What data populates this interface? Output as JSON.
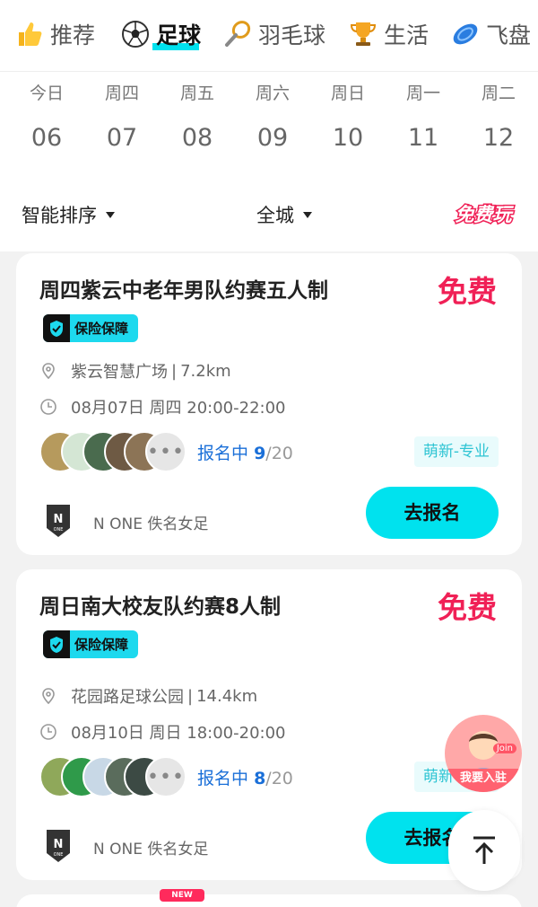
{
  "categories": [
    {
      "label": "推荐",
      "icon": "thumbs-up-icon",
      "active": false
    },
    {
      "label": "足球",
      "icon": "soccer-ball-icon",
      "active": true
    },
    {
      "label": "羽毛球",
      "icon": "badminton-racket-icon",
      "active": false
    },
    {
      "label": "生活",
      "icon": "trophy-icon",
      "active": false
    },
    {
      "label": "飞盘",
      "icon": "frisbee-icon",
      "active": false
    }
  ],
  "dates": [
    {
      "weekday": "今日",
      "day": "06"
    },
    {
      "weekday": "周四",
      "day": "07"
    },
    {
      "weekday": "周五",
      "day": "08"
    },
    {
      "weekday": "周六",
      "day": "09"
    },
    {
      "weekday": "周日",
      "day": "10"
    },
    {
      "weekday": "周一",
      "day": "11"
    },
    {
      "weekday": "周二",
      "day": "12"
    }
  ],
  "filters": {
    "sort_label": "智能排序",
    "city_label": "全城",
    "badge": "免费玩"
  },
  "accent_color": "#00e2ee",
  "price_color": "#f02056",
  "events": [
    {
      "title": "周四紫云中老年男队约赛五人制",
      "price": "免费",
      "insurance": "保险保障",
      "location": "紫云智慧广场",
      "distance": "7.2km",
      "time": "08月07日 周四 20:00-22:00",
      "status": "报名中",
      "count": "9",
      "total": "/20",
      "level": "萌新-专业",
      "org": "N ONE 佚名女足",
      "button": "去报名"
    },
    {
      "title": "周日南大校友队约赛8人制",
      "price": "免费",
      "insurance": "保险保障",
      "location": "花园路足球公园",
      "distance": "14.4km",
      "time": "08月10日 周日 18:00-20:00",
      "status": "报名中",
      "count": "8",
      "total": "/20",
      "level": "萌新-专业",
      "org": "N ONE 佚名女足",
      "button": "去报名"
    }
  ],
  "new_tag": "NEW",
  "join_button": {
    "label": "我要入驻",
    "tag": "Join"
  }
}
